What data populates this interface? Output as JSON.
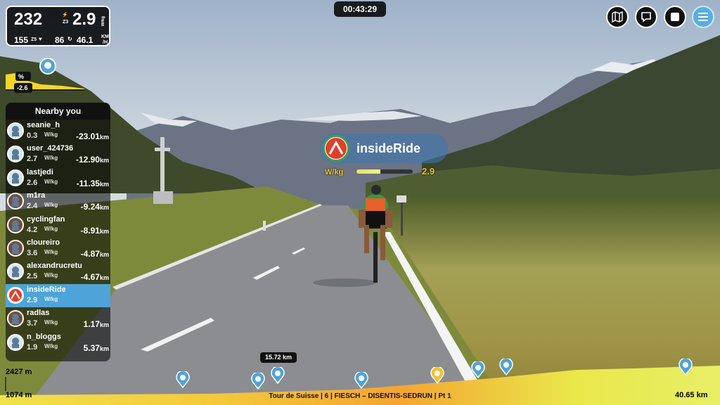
{
  "stats": {
    "power": "232",
    "zone": "Z3",
    "wkg": "2.9",
    "wkg_unit": "W/kg",
    "hr": "155",
    "hr_zone": "Z5",
    "cadence": "86",
    "speed": "46.1",
    "speed_unit_top": "KM",
    "speed_unit_bottom": "/H"
  },
  "timer": "00:43:29",
  "top_buttons": [
    {
      "icon": "map-icon"
    },
    {
      "icon": "chat-icon"
    },
    {
      "icon": "stop-icon"
    },
    {
      "icon": "menu-icon"
    }
  ],
  "grade": {
    "label": "%",
    "value": "-2.6"
  },
  "nearby": {
    "title": "Nearby you",
    "wkg_unit": "W/kg",
    "dist_unit": "km",
    "riders": [
      {
        "name": "seanie_h",
        "wkg": "0.3",
        "dist": "-23.01",
        "avatar": "default",
        "active": false
      },
      {
        "name": "user_424736",
        "wkg": "2.7",
        "dist": "-12.90",
        "avatar": "default",
        "active": false
      },
      {
        "name": "lastjedi",
        "wkg": "2.6",
        "dist": "-11.35",
        "avatar": "default",
        "active": false
      },
      {
        "name": "m1ra",
        "wkg": "2.4",
        "dist": "-9.24",
        "avatar": "photo",
        "active": false
      },
      {
        "name": "cyclingfan",
        "wkg": "4.2",
        "dist": "-8.91",
        "avatar": "photo",
        "active": false
      },
      {
        "name": "cloureiro",
        "wkg": "3.6",
        "dist": "-4.87",
        "avatar": "photo",
        "active": false
      },
      {
        "name": "alexandrucretu",
        "wkg": "2.5",
        "dist": "-4.67",
        "avatar": "default",
        "active": false
      },
      {
        "name": "insideRide",
        "wkg": "2.9",
        "dist": "",
        "avatar": "logo",
        "active": true
      },
      {
        "name": "radlas",
        "wkg": "3.7",
        "dist": "1.17",
        "avatar": "photo",
        "active": false
      },
      {
        "name": "n_bloggs",
        "wkg": "1.9",
        "dist": "5.37",
        "avatar": "default",
        "active": false
      }
    ]
  },
  "player": {
    "name": "insideRide",
    "wkg_label": "W/kg",
    "wkg_value": "2.9",
    "wkg_fraction": 0.42
  },
  "profile": {
    "elev_max": "2427 m",
    "elev_min": "1074 m",
    "distance_done": "15.72 km",
    "total": "40.65 km",
    "course": "Tour de Suisse | 6 | FIESCH – DISENTIS-SEDRUN | Pt 1"
  },
  "colors": {
    "accent": "#4ea4d8",
    "power": "#f5c518",
    "brand_green": "#3ea055",
    "brand_red": "#e0402a"
  }
}
